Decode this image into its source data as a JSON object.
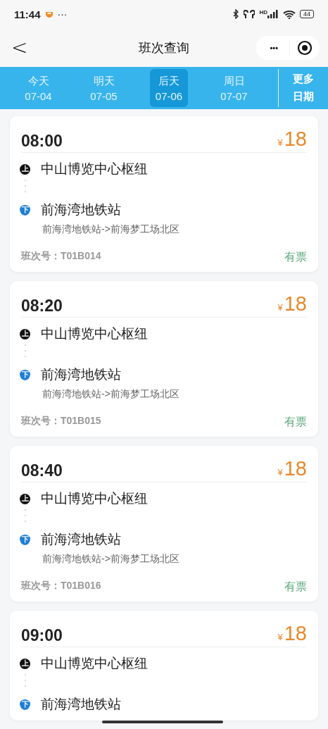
{
  "status_bar": {
    "time": "11:44",
    "more": "···",
    "network": "HD",
    "battery": "44"
  },
  "nav": {
    "back": "<",
    "title": "班次查询",
    "menu": "•••"
  },
  "dates": [
    {
      "day": "今天",
      "date": "07-04",
      "selected": false
    },
    {
      "day": "明天",
      "date": "07-05",
      "selected": false
    },
    {
      "day": "后天",
      "date": "07-06",
      "selected": true
    },
    {
      "day": "周日",
      "date": "07-07",
      "selected": false
    }
  ],
  "more_dates": [
    "更多",
    "日期"
  ],
  "trips": [
    {
      "time": "08:00",
      "currency": "¥",
      "price": "18",
      "board_mark": "上",
      "board": "中山博览中心枢纽",
      "alight_mark": "下",
      "alight": "前海湾地铁站",
      "route": "前海湾地铁站->前海梦工场北区",
      "number": "班次号：T01B014",
      "availability": "有票"
    },
    {
      "time": "08:20",
      "currency": "¥",
      "price": "18",
      "board_mark": "上",
      "board": "中山博览中心枢纽",
      "alight_mark": "下",
      "alight": "前海湾地铁站",
      "route": "前海湾地铁站->前海梦工场北区",
      "number": "班次号：T01B015",
      "availability": "有票"
    },
    {
      "time": "08:40",
      "currency": "¥",
      "price": "18",
      "board_mark": "上",
      "board": "中山博览中心枢纽",
      "alight_mark": "下",
      "alight": "前海湾地铁站",
      "route": "前海湾地铁站->前海梦工场北区",
      "number": "班次号：T01B016",
      "availability": "有票"
    },
    {
      "time": "09:00",
      "currency": "¥",
      "price": "18",
      "board_mark": "上",
      "board": "中山博览中心枢纽",
      "alight_mark": "下",
      "alight": "前海湾地铁站"
    }
  ]
}
